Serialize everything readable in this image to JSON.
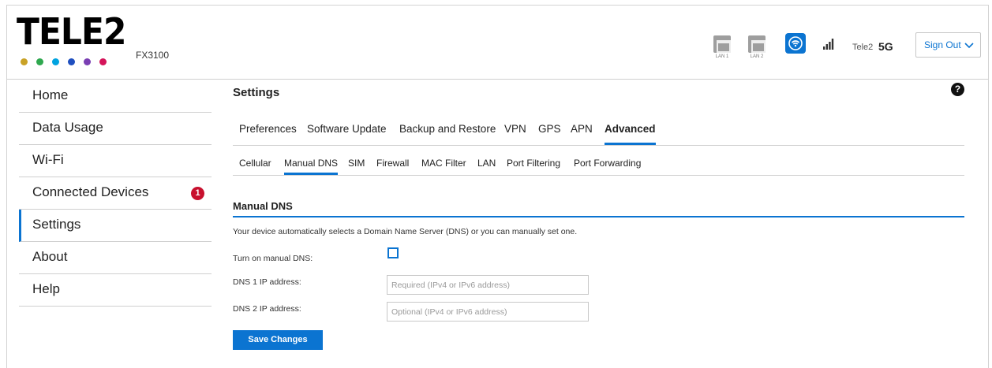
{
  "header": {
    "brand": "TELE2",
    "brand_dot_colors": [
      "#c9a227",
      "#2fa84f",
      "#00a3e0",
      "#1f4fbf",
      "#7a3fb3",
      "#d4145a"
    ],
    "model": "FX3100",
    "ports": [
      {
        "label": "LAN 1",
        "icon": "ethernet-port-icon"
      },
      {
        "label": "LAN 2",
        "icon": "ethernet-port-icon"
      }
    ],
    "wifi_icon": "wifi-icon",
    "signal_icon": "signal-bars-icon",
    "carrier": "Tele2",
    "network_type": "5G",
    "sign_out_label": "Sign Out"
  },
  "sidebar": {
    "items": [
      {
        "label": "Home"
      },
      {
        "label": "Data Usage"
      },
      {
        "label": "Wi-Fi"
      },
      {
        "label": "Connected Devices",
        "badge": "1"
      },
      {
        "label": "Settings",
        "active": true
      },
      {
        "label": "About"
      },
      {
        "label": "Help"
      }
    ]
  },
  "main": {
    "title": "Settings",
    "help_icon": "?",
    "tabs": [
      "Preferences",
      "Software Update",
      "Backup and Restore",
      "VPN",
      "GPS",
      "APN",
      "Advanced"
    ],
    "active_tab": "Advanced",
    "subtabs": [
      "Cellular",
      "Manual DNS",
      "SIM",
      "Firewall",
      "MAC Filter",
      "LAN",
      "Port Filtering",
      "Port Forwarding"
    ],
    "active_subtab": "Manual DNS",
    "section": {
      "title": "Manual DNS",
      "description": "Your device automatically selects a Domain Name Server (DNS) or you can manually set one.",
      "manual_dns_label": "Turn on manual DNS:",
      "manual_dns_checked": false,
      "dns1_label": "DNS 1 IP address:",
      "dns1_value": "",
      "dns1_placeholder": "Required (IPv4 or IPv6 address)",
      "dns2_label": "DNS 2 IP address:",
      "dns2_value": "",
      "dns2_placeholder": "Optional (IPv4 or IPv6 address)",
      "save_label": "Save Changes"
    }
  },
  "colors": {
    "accent": "#0b74d1",
    "badge": "#c8102e"
  }
}
